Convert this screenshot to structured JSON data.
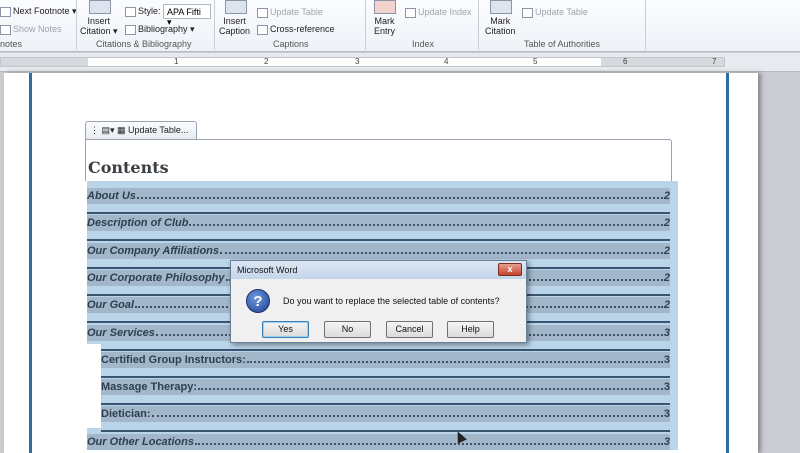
{
  "ribbon": {
    "footnotes": {
      "next_footnote": "Next Footnote",
      "show_notes": "Show Notes",
      "group": "notes"
    },
    "citations": {
      "insert_citation": [
        "Insert",
        "Citation"
      ],
      "style_label": "Style:",
      "style_value": "APA Fifti",
      "bibliography": "Bibliography",
      "group": "Citations & Bibliography"
    },
    "captions": {
      "insert_caption": [
        "Insert",
        "Caption"
      ],
      "update_table": "Update Table",
      "cross_reference": "Cross-reference",
      "group": "Captions"
    },
    "index": {
      "mark_entry": [
        "Mark",
        "Entry"
      ],
      "update_index": "Update Index",
      "group": "Index"
    },
    "authorities": {
      "mark_citation": [
        "Mark",
        "Citation"
      ],
      "update_table": "Update Table",
      "group": "Table of Authorities"
    }
  },
  "ruler": {
    "numbers": [
      "1",
      "2",
      "3",
      "4",
      "5",
      "6",
      "7"
    ]
  },
  "content_control": {
    "update_table": "Update Table..."
  },
  "document": {
    "title": "Contents",
    "toc": [
      {
        "text": "About Us",
        "page": "2",
        "level": 1
      },
      {
        "text": "Description of Club",
        "page": "2",
        "level": 1
      },
      {
        "text": "Our Company Affiliations",
        "page": "2",
        "level": 1
      },
      {
        "text": "Our Corporate Philosophy",
        "page": "2",
        "level": 1
      },
      {
        "text": "Our Goal",
        "page": "2",
        "level": 1
      },
      {
        "text": "Our Services",
        "page": "3",
        "level": 1
      },
      {
        "text": "Certified Group Instructors: ",
        "page": "3",
        "level": 2
      },
      {
        "text": "Massage Therapy: ",
        "page": "3",
        "level": 2
      },
      {
        "text": "Dietician:",
        "page": "3",
        "level": 2
      },
      {
        "text": "Our Other Locations",
        "page": "3",
        "level": 1
      }
    ]
  },
  "dialog": {
    "title": "Microsoft Word",
    "message": "Do you want to replace the selected table of contents?",
    "close": "x",
    "buttons": {
      "yes": "Yes",
      "no": "No",
      "cancel": "Cancel",
      "help": "Help"
    }
  }
}
